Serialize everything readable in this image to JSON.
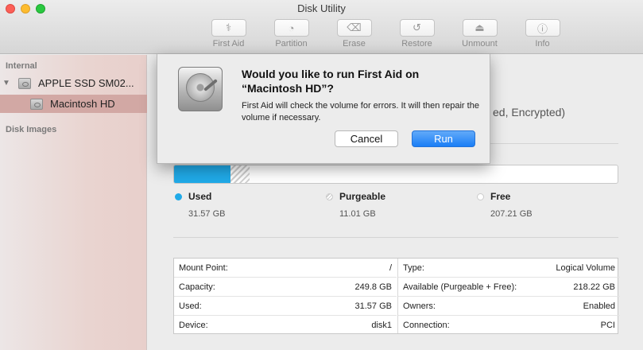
{
  "window": {
    "title": "Disk Utility"
  },
  "toolbar": {
    "items": [
      {
        "label": "First Aid",
        "icon": "stethoscope-icon",
        "glyph": "⚕"
      },
      {
        "label": "Partition",
        "icon": "partition-icon",
        "glyph": "◔"
      },
      {
        "label": "Erase",
        "icon": "erase-icon",
        "glyph": "⌫"
      },
      {
        "label": "Restore",
        "icon": "restore-icon",
        "glyph": "↺"
      },
      {
        "label": "Unmount",
        "icon": "eject-icon",
        "glyph": "⏏"
      },
      {
        "label": "Info",
        "icon": "info-icon",
        "glyph": "ⓘ"
      }
    ]
  },
  "sidebar": {
    "internal_label": "Internal",
    "disk_images_label": "Disk Images",
    "items": [
      {
        "label": "APPLE SSD SM02...",
        "icon": "internal-disk-icon"
      },
      {
        "label": "Macintosh HD",
        "icon": "volume-icon",
        "selected": true
      }
    ]
  },
  "volume": {
    "partial_info": "ed, Encrypted)",
    "usage": {
      "used_fraction": 0.127,
      "purgeable_fraction": 0.044
    },
    "legend": {
      "used": {
        "label": "Used",
        "value": "31.57 GB"
      },
      "purgeable": {
        "label": "Purgeable",
        "value": "11.01 GB"
      },
      "free": {
        "label": "Free",
        "value": "207.21 GB"
      }
    },
    "info_left": [
      {
        "key": "Mount Point:",
        "value": "/"
      },
      {
        "key": "Capacity:",
        "value": "249.8 GB"
      },
      {
        "key": "Used:",
        "value": "31.57 GB"
      },
      {
        "key": "Device:",
        "value": "disk1"
      }
    ],
    "info_right": [
      {
        "key": "Type:",
        "value": "Logical Volume"
      },
      {
        "key": "Available (Purgeable + Free):",
        "value": "218.22 GB"
      },
      {
        "key": "Owners:",
        "value": "Enabled"
      },
      {
        "key": "Connection:",
        "value": "PCI"
      }
    ]
  },
  "dialog": {
    "title": "Would you like to run First Aid on “Macintosh HD”?",
    "message": "First Aid will check the volume for errors. It will then repair the volume if necessary.",
    "cancel_label": "Cancel",
    "run_label": "Run",
    "icon": "hard-drive-icon"
  },
  "colors": {
    "used": "#20aae8",
    "accent": "#1a7ef6",
    "sidebar_selected": "#d2a8a4"
  }
}
